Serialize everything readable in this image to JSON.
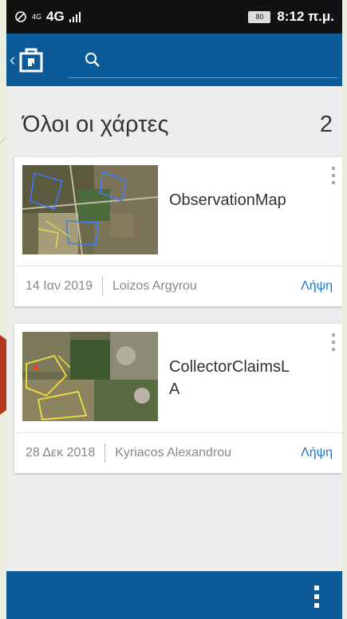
{
  "status_bar": {
    "network": "4G",
    "network_small": "4G",
    "battery": "80",
    "time": "8:12 π.μ."
  },
  "app_bar": {
    "back_icon": "chevron-left-icon",
    "app_icon": "collector-app-icon",
    "search_icon": "search-icon"
  },
  "header": {
    "title": "Όλοι οι χάρτες",
    "count": "2"
  },
  "maps": [
    {
      "name": "ObservationMap",
      "date": "14 Ιαν 2019",
      "owner": "Loizos Argyrou",
      "action": "Λήψη"
    },
    {
      "name": "CollectorClaimsLA",
      "date": "28 Δεκ 2018",
      "owner": "Kyriacos Alexandrou",
      "action": "Λήψη"
    }
  ],
  "bottom_bar": {
    "menu_icon": "more-vertical-icon"
  },
  "colors": {
    "primary": "#0c5a97",
    "accent": "#1d72c2",
    "background": "#ededed"
  }
}
